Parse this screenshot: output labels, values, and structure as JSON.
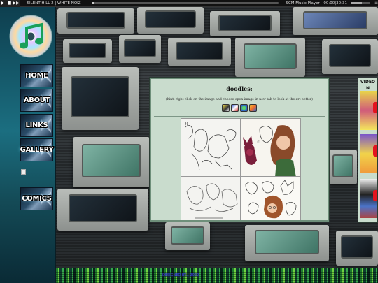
{
  "player": {
    "play_icon": "play-icon",
    "stop_icon": "stop-icon",
    "menu_icon": "menu-icon",
    "track_title": "SILENT HILL 2 | WHITE NOIZ",
    "player_name": "SCM Music Player",
    "time": "00:00|30:31",
    "progress_fraction": 0.01,
    "volume_fraction": 0.55
  },
  "sidebar": {
    "logo_icon": "itunes-music-note-cd-icon",
    "items": [
      {
        "label": "HOME"
      },
      {
        "label": "ABOUT"
      },
      {
        "label": "LINKS"
      },
      {
        "label": "GALLERY"
      },
      {
        "label": "COMICS"
      }
    ]
  },
  "main": {
    "title": "doodles:",
    "hint": "(hint: right click on the image and choose open image in new tab to look at the art better)",
    "stamps": [
      "stamp-icon-1",
      "stamp-icon-2",
      "stamp-icon-3",
      "stamp-icon-4"
    ],
    "thumbnails": [
      "doodle-sketch-1",
      "doodle-color-2",
      "doodle-sketch-3",
      "doodle-color-4"
    ]
  },
  "videos": {
    "title_line1": "VIDEO",
    "title_line2": "N"
  },
  "footer": {
    "text": "DESIGNED BY... 2022"
  },
  "colors": {
    "sidebar": "#1b6e80",
    "panel": "#c9dccd",
    "panel_border": "#6e8f7a",
    "glitch_green": "#35a64c"
  }
}
